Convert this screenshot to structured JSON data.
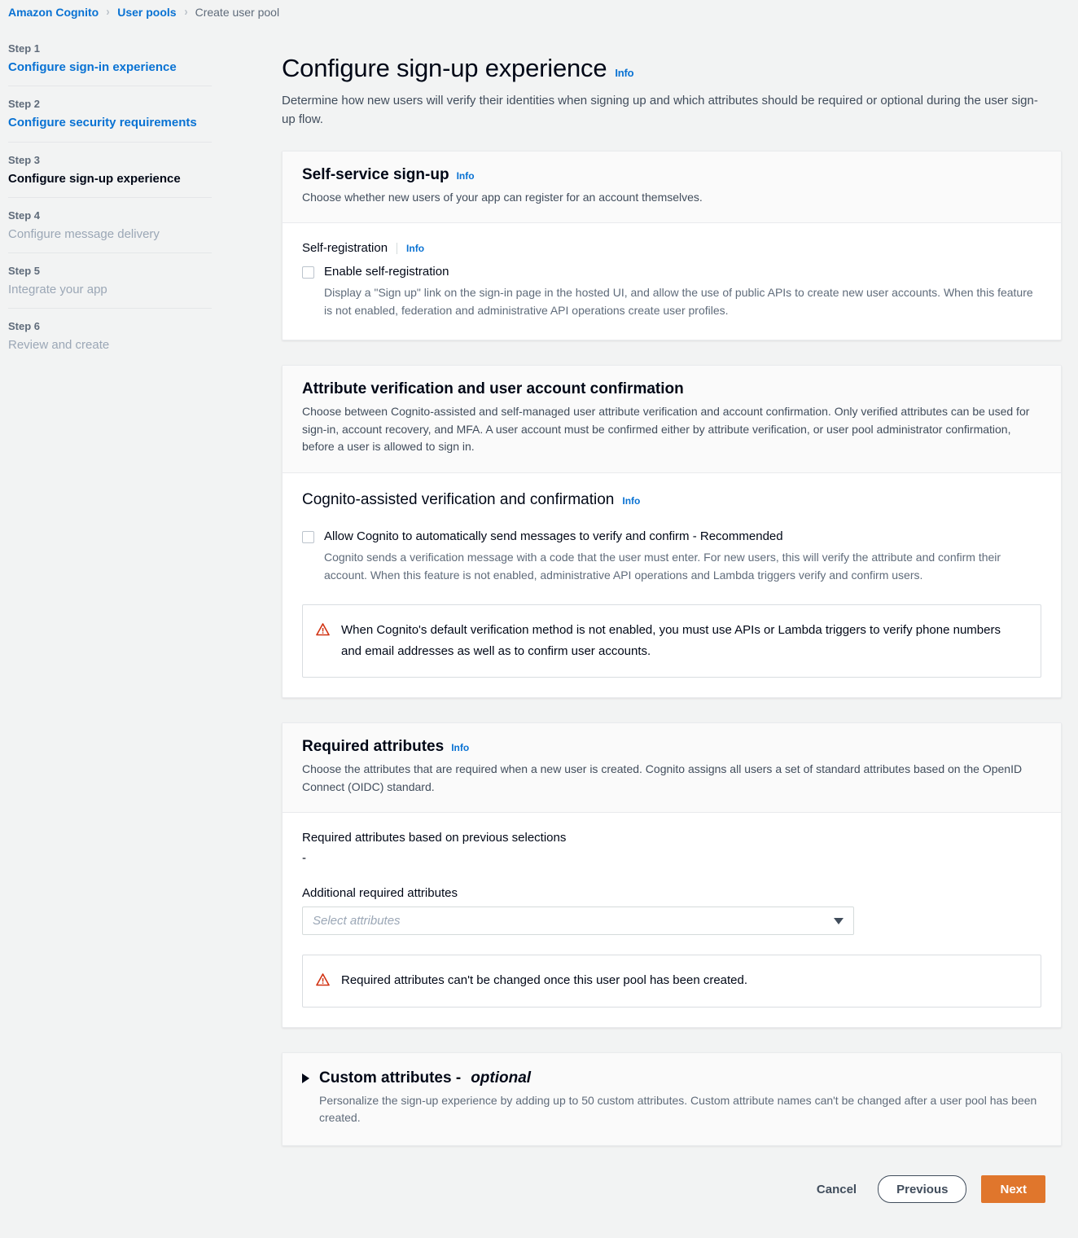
{
  "breadcrumb": {
    "items": [
      {
        "label": "Amazon Cognito",
        "type": "link"
      },
      {
        "label": "User pools",
        "type": "link"
      },
      {
        "label": "Create user pool",
        "type": "current"
      }
    ],
    "separator": "›"
  },
  "sidebar": {
    "steps": [
      {
        "num": "Step 1",
        "title": "Configure sign-in experience",
        "state": "link"
      },
      {
        "num": "Step 2",
        "title": "Configure security requirements",
        "state": "link"
      },
      {
        "num": "Step 3",
        "title": "Configure sign-up experience",
        "state": "active"
      },
      {
        "num": "Step 4",
        "title": "Configure message delivery",
        "state": "muted"
      },
      {
        "num": "Step 5",
        "title": "Integrate your app",
        "state": "muted"
      },
      {
        "num": "Step 6",
        "title": "Review and create",
        "state": "muted"
      }
    ]
  },
  "page": {
    "title": "Configure sign-up experience",
    "info_label": "Info",
    "description": "Determine how new users will verify their identities when signing up and which attributes should be required or optional during the user sign-up flow."
  },
  "self_service": {
    "title": "Self-service sign-up",
    "info_label": "Info",
    "subtitle": "Choose whether new users of your app can register for an account themselves.",
    "field_label": "Self-registration",
    "field_info_label": "Info",
    "checkbox_label": "Enable self-registration",
    "checkbox_checked": false,
    "checkbox_description": "Display a \"Sign up\" link on the sign-in page in the hosted UI, and allow the use of public APIs to create new user accounts. When this feature is not enabled, federation and administrative API operations create user profiles."
  },
  "attribute_verification": {
    "title": "Attribute verification and user account confirmation",
    "subtitle": "Choose between Cognito-assisted and self-managed user attribute verification and account confirmation. Only verified attributes can be used for sign-in, account recovery, and MFA. A user account must be confirmed either by attribute verification, or user pool administrator confirmation, before a user is allowed to sign in.",
    "subsection_title": "Cognito-assisted verification and confirmation",
    "subsection_info_label": "Info",
    "checkbox_label": "Allow Cognito to automatically send messages to verify and confirm - Recommended",
    "checkbox_checked": false,
    "checkbox_description": "Cognito sends a verification message with a code that the user must enter. For new users, this will verify the attribute and confirm their account. When this feature is not enabled, administrative API operations and Lambda triggers verify and confirm users.",
    "alert_text": "When Cognito's default verification method is not enabled, you must use APIs or Lambda triggers to verify phone numbers and email addresses as well as to confirm user accounts.",
    "alert_icon": "warning-triangle-icon"
  },
  "required_attributes": {
    "title": "Required attributes",
    "info_label": "Info",
    "subtitle": "Choose the attributes that are required when a new user is created. Cognito assigns all users a set of standard attributes based on the OpenID Connect (OIDC) standard.",
    "previous_selections_label": "Required attributes based on previous selections",
    "previous_selections_value": "-",
    "additional_label": "Additional required attributes",
    "select_placeholder": "Select attributes",
    "select_value": "",
    "alert_text": "Required attributes can't be changed once this user pool has been created.",
    "alert_icon": "warning-triangle-icon"
  },
  "custom_attributes": {
    "title": "Custom attributes - ",
    "title_optional": "optional",
    "expanded": false,
    "description": "Personalize the sign-up experience by adding up to 50 custom attributes. Custom attribute names can't be changed after a user pool has been created."
  },
  "footer": {
    "cancel_label": "Cancel",
    "previous_label": "Previous",
    "next_label": "Next"
  },
  "colors": {
    "link": "#0972d3",
    "primary_button": "#e0762c",
    "warning": "#d13212",
    "page_background": "#f2f3f3"
  }
}
